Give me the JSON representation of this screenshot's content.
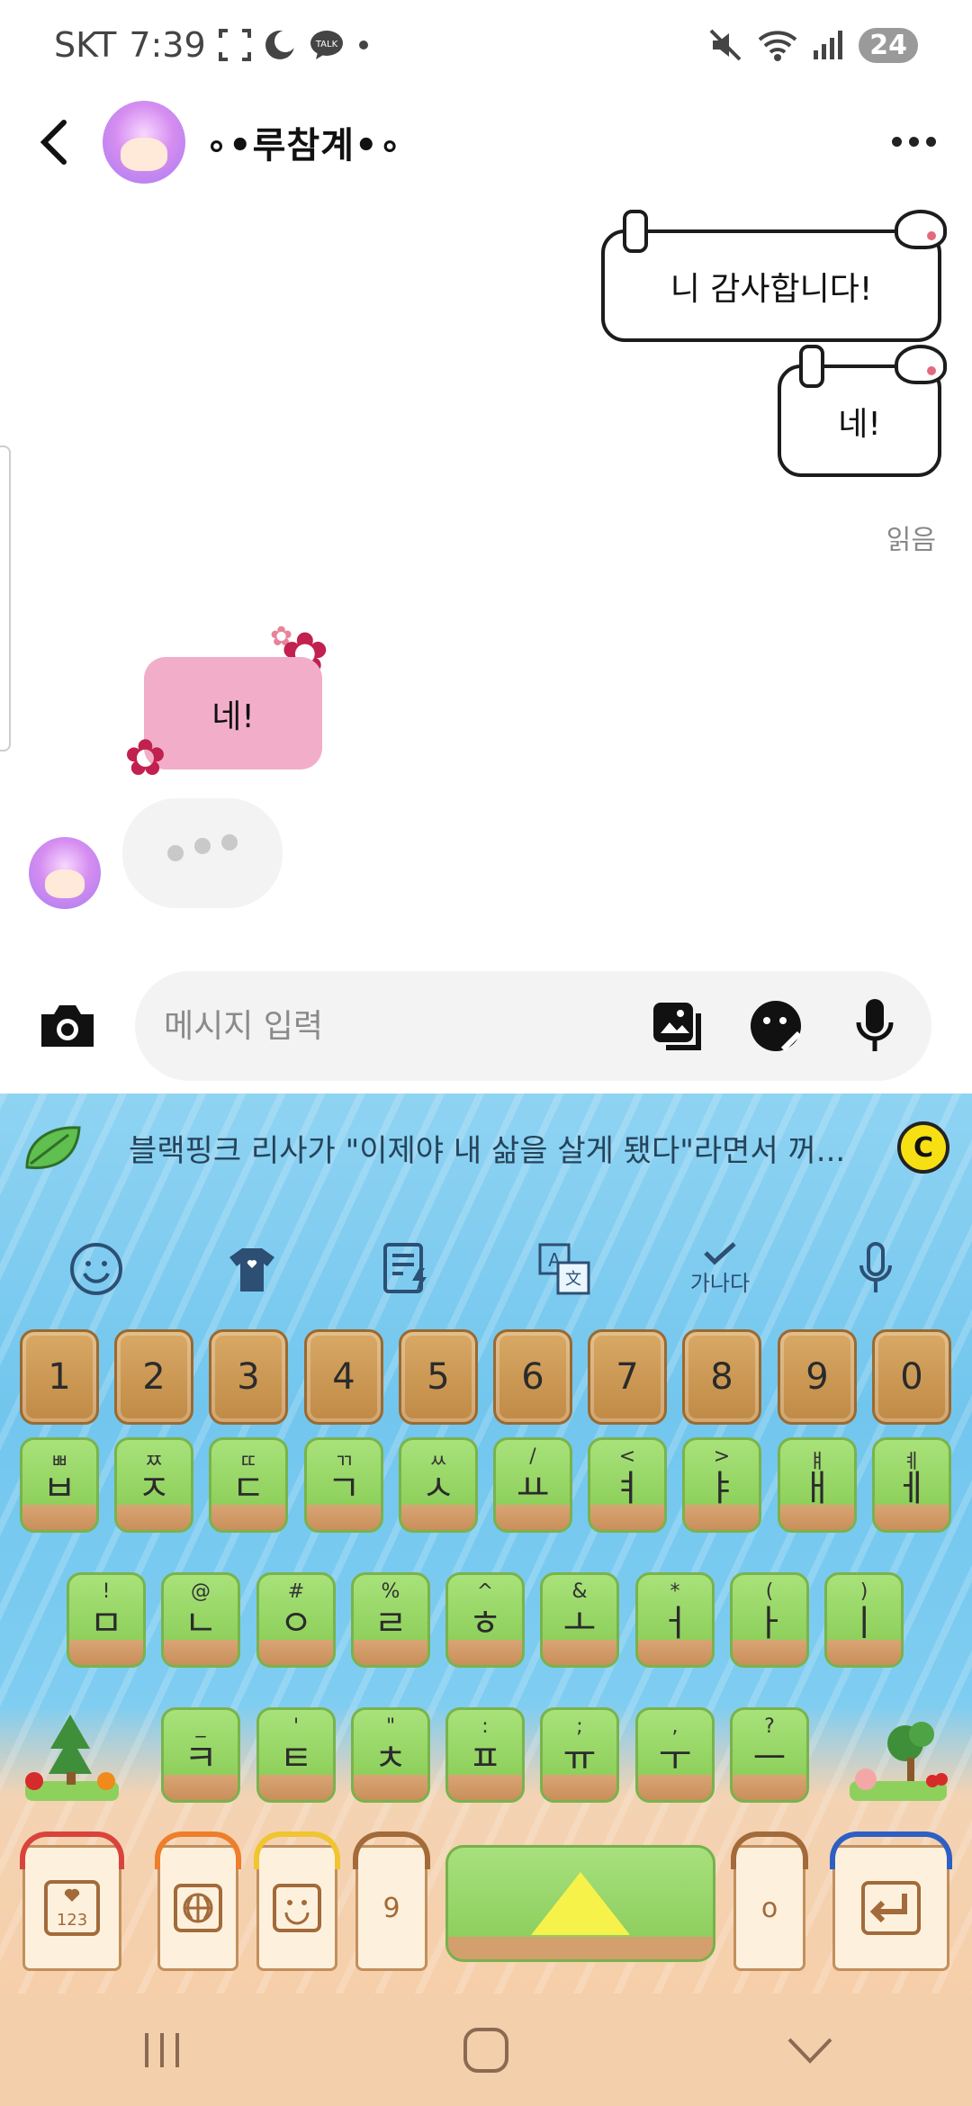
{
  "status_bar": {
    "carrier": "SKT",
    "time": "7:39",
    "battery": "24"
  },
  "header": {
    "title": "∘•루참계•∘"
  },
  "messages": {
    "sent": [
      {
        "text": "니 감사합니다!"
      },
      {
        "text": "네!"
      }
    ],
    "read_label": "읽음",
    "received": [
      {
        "text": "네!"
      }
    ]
  },
  "input": {
    "placeholder": "메시지 입력"
  },
  "keyboard": {
    "suggestion": "블랙핑크 리사가 \"이제야 내 삶을 살게 됐다\"라면서 꺼...",
    "coin_label": "C",
    "toolbar": {
      "hangul_label": "가나다"
    },
    "number_row": [
      "1",
      "2",
      "3",
      "4",
      "5",
      "6",
      "7",
      "8",
      "9",
      "0"
    ],
    "row1": [
      {
        "main": "ㅂ",
        "sub": "ㅃ"
      },
      {
        "main": "ㅈ",
        "sub": "ㅉ"
      },
      {
        "main": "ㄷ",
        "sub": "ㄸ"
      },
      {
        "main": "ㄱ",
        "sub": "ㄲ"
      },
      {
        "main": "ㅅ",
        "sub": "ㅆ"
      },
      {
        "main": "ㅛ",
        "sub": "/"
      },
      {
        "main": "ㅕ",
        "sub": "<"
      },
      {
        "main": "ㅑ",
        "sub": ">"
      },
      {
        "main": "ㅐ",
        "sub": "ㅒ"
      },
      {
        "main": "ㅔ",
        "sub": "ㅖ"
      }
    ],
    "row2": [
      {
        "main": "ㅁ",
        "sub": "!"
      },
      {
        "main": "ㄴ",
        "sub": "@"
      },
      {
        "main": "ㅇ",
        "sub": "#"
      },
      {
        "main": "ㄹ",
        "sub": "%"
      },
      {
        "main": "ㅎ",
        "sub": "^"
      },
      {
        "main": "ㅗ",
        "sub": "&"
      },
      {
        "main": "ㅓ",
        "sub": "*"
      },
      {
        "main": "ㅏ",
        "sub": "("
      },
      {
        "main": "ㅣ",
        "sub": ")"
      }
    ],
    "row3": [
      {
        "main": "ㅋ",
        "sub": "_"
      },
      {
        "main": "ㅌ",
        "sub": "'"
      },
      {
        "main": "ㅊ",
        "sub": "\""
      },
      {
        "main": "ㅍ",
        "sub": ":"
      },
      {
        "main": "ㅠ",
        "sub": ";"
      },
      {
        "main": "ㅜ",
        "sub": ","
      },
      {
        "main": "ㅡ",
        "sub": "?"
      }
    ],
    "bottom_row": {
      "num_key": "123",
      "comma_key": "9",
      "period_key": "o"
    }
  },
  "colors": {
    "received_bubble": "#f2aec8",
    "keyboard_water": "#7fcdf1",
    "keyboard_sand": "#f6cfaa",
    "key_grass": "#8ed05c",
    "key_wood": "#c98f5b"
  }
}
